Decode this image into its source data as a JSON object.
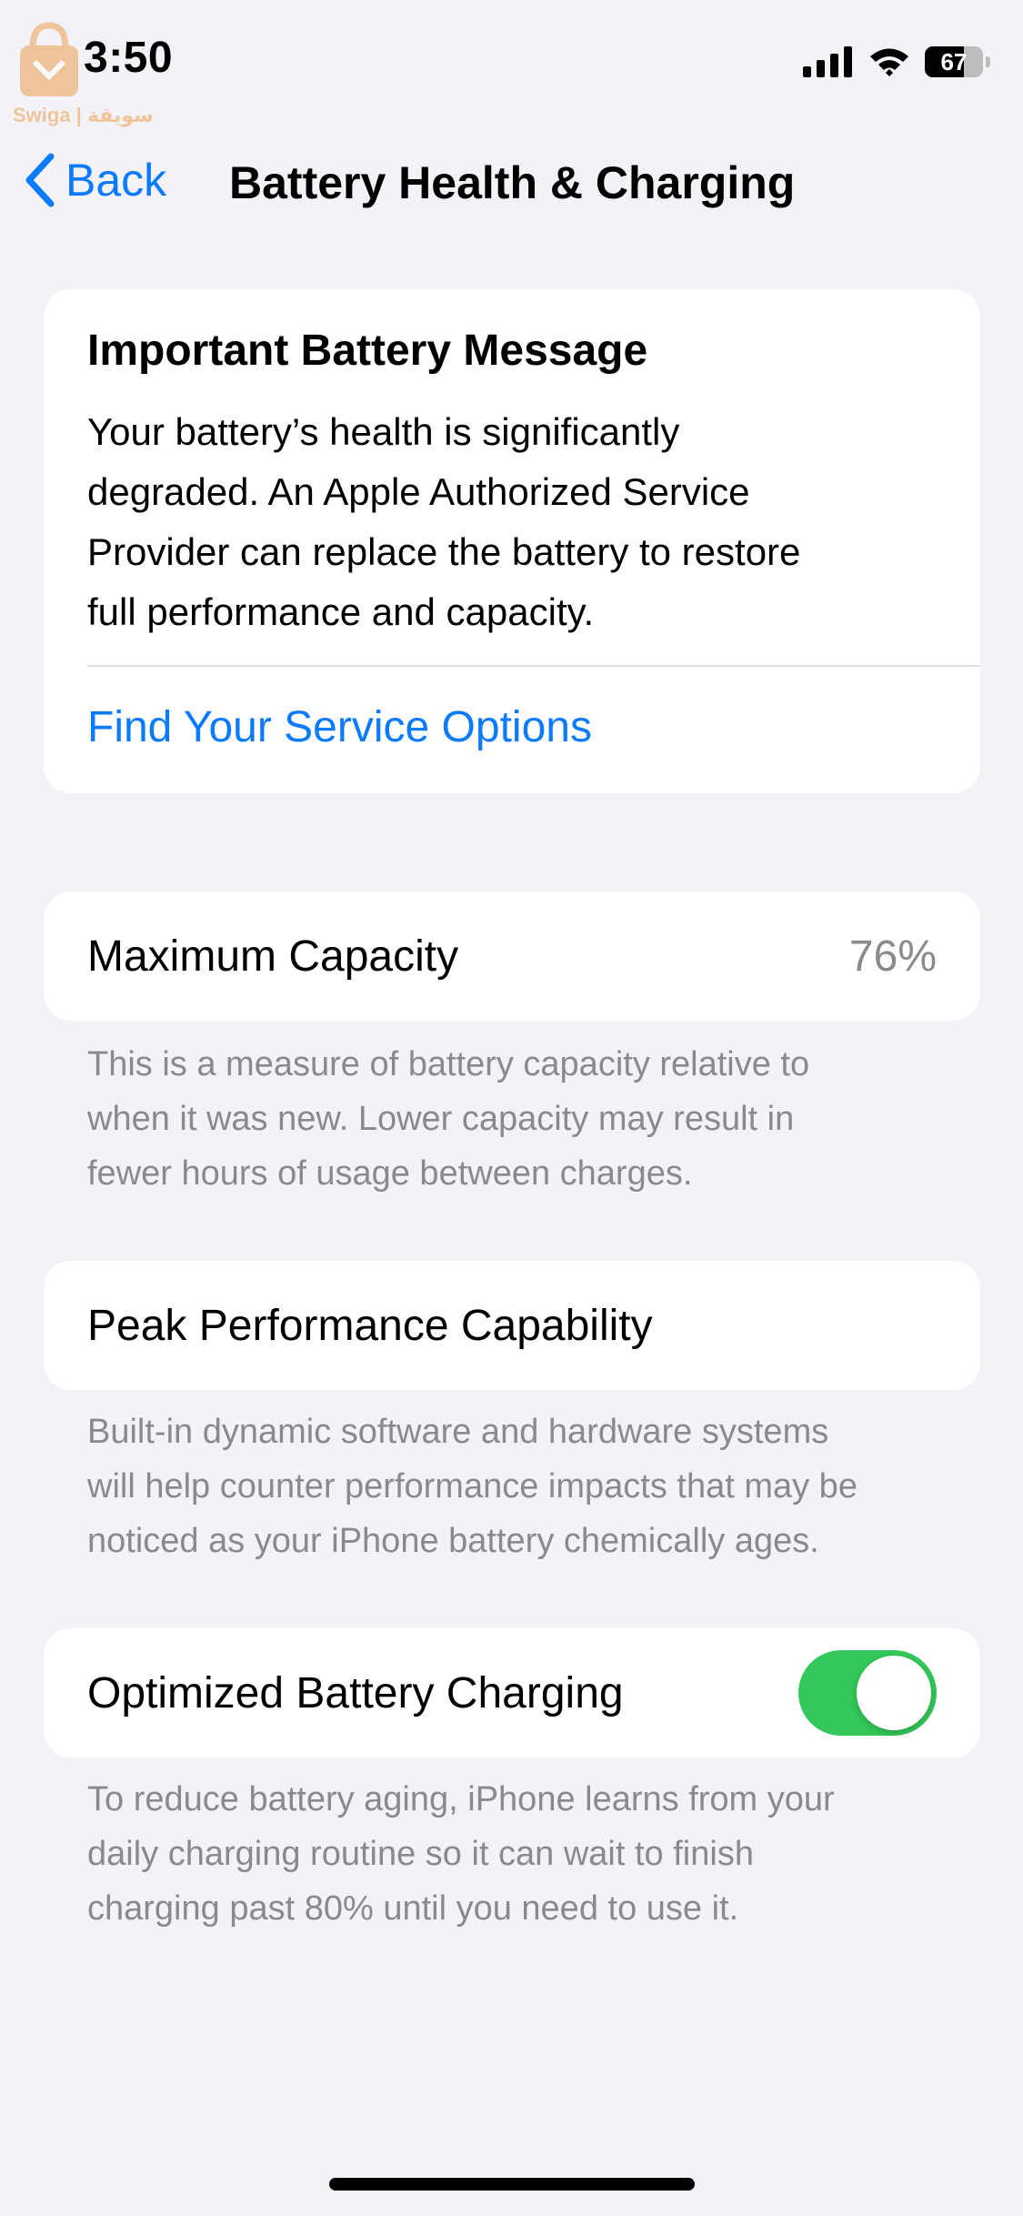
{
  "status_bar": {
    "time": "3:50",
    "battery_percent": "67",
    "battery_level": 0.67,
    "watermark_text": "Swiga | سويقة",
    "icons": [
      "signal-icon",
      "wifi-icon",
      "battery-icon"
    ]
  },
  "nav": {
    "back_label": "Back",
    "title": "Battery Health & Charging",
    "back_icon": "chevron-left-icon"
  },
  "message_card": {
    "title": "Important Battery Message",
    "body_lines": [
      "Your battery’s health is significantly",
      "degraded. An Apple Authorized Service",
      "Provider can replace the battery to restore",
      "full performance and capacity."
    ],
    "link": "Find Your Service Options"
  },
  "max_capacity": {
    "label": "Maximum Capacity",
    "value": "76%",
    "footnote_lines": [
      "This is a measure of battery capacity relative to",
      "when it was new. Lower capacity may result in",
      "fewer hours of usage between charges."
    ]
  },
  "peak_performance": {
    "label": "Peak Performance Capability",
    "footnote_lines": [
      "Built-in dynamic software and hardware systems",
      "will help counter performance impacts that may be",
      "noticed as your iPhone battery chemically ages."
    ]
  },
  "optimized_charging": {
    "label": "Optimized Battery Charging",
    "enabled": true,
    "footnote_lines": [
      "To reduce battery aging, iPhone learns from your",
      "daily charging routine so it can wait to finish",
      "charging past 80% until you need to use it."
    ]
  },
  "colors": {
    "accent": "#0a7aff",
    "toggle_on": "#34c759",
    "background": "#f2f2f7",
    "secondary_text": "#8a8a8e"
  }
}
